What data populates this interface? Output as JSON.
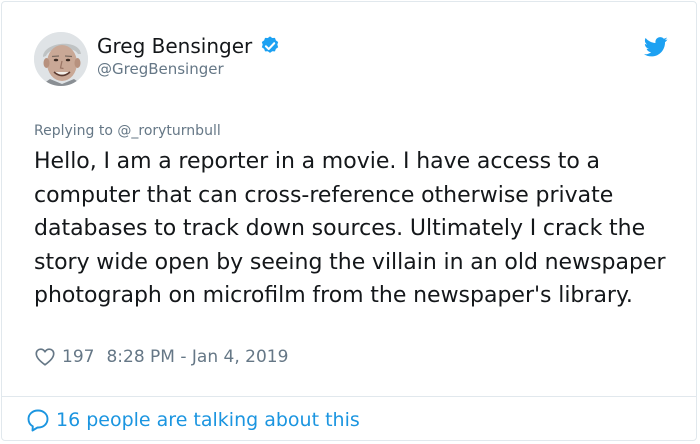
{
  "author": {
    "display_name": "Greg Bensinger",
    "handle": "@GregBensinger",
    "avatar_icon": "person-avatar",
    "verified": true
  },
  "tweet": {
    "replying_to": "Replying to @_roryturnbull",
    "text": "Hello, I am a reporter in a movie. I have access to a computer that can cross-reference otherwise private databases to track down sources. Ultimately I crack the story wide open by seeing the villain in an old newspaper photograph on microfilm from the newspaper's library.",
    "like_count": "197",
    "timestamp": "8:28 PM - Jan 4, 2019"
  },
  "footer": {
    "talking_text": "16 people are talking about this"
  },
  "colors": {
    "brand_blue": "#1da1f2",
    "link_blue": "#1b95e0",
    "muted_gray": "#657786",
    "text_dark": "#14171a",
    "border": "#e1e8ed"
  }
}
